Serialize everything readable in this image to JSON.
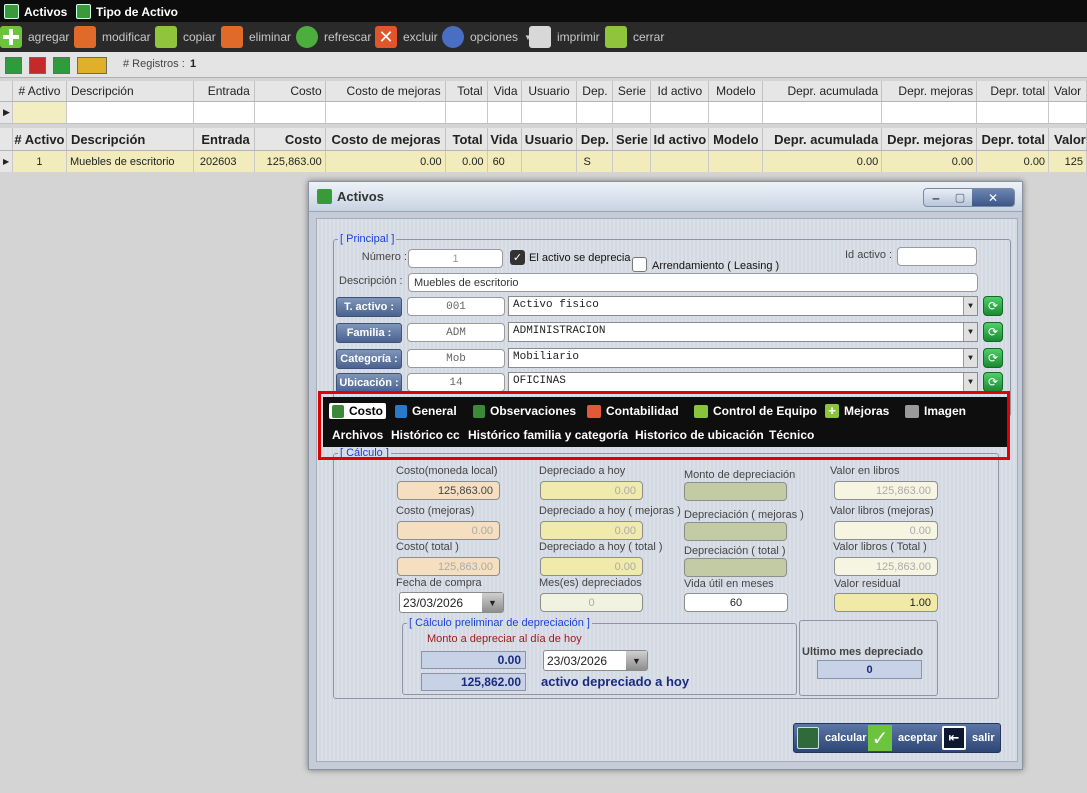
{
  "menu": {
    "item1": "Activos",
    "item2": "Tipo de Activo"
  },
  "toolbar": {
    "agregar": "agregar",
    "modificar": "modificar",
    "copiar": "copiar",
    "eliminar": "eliminar",
    "refrescar": "refrescar",
    "excluir": "excluir",
    "opciones": "opciones",
    "imprimir": "imprimir",
    "cerrar": "cerrar"
  },
  "nav": {
    "registros_label": "# Registros :",
    "registros_value": "1"
  },
  "columns": [
    "# Activo",
    "Descripción",
    "Entrada",
    "Costo",
    "Costo de mejoras",
    "Total",
    "Vida",
    "Usuario",
    "Dep.",
    "Serie",
    "Id activo",
    "Modelo",
    "Depr. acumulada",
    "Depr. mejoras",
    "Depr. total",
    "Valor"
  ],
  "row": {
    "activo": "1",
    "descripcion": "Muebles de escritorio",
    "entrada": "202603",
    "costo": "125,863.00",
    "costo_mejoras": "0.00",
    "total": "0.00",
    "vida": "60",
    "usuario": "",
    "dep": "S",
    "serie": "",
    "id_activo": "",
    "modelo": "",
    "depr_acumulada": "0.00",
    "depr_mejoras": "0.00",
    "depr_total": "0.00",
    "valor": "125"
  },
  "dialog": {
    "title": "Activos",
    "principal": {
      "legend": "[ Principal ]",
      "numero_label": "Número :",
      "numero_value": "1",
      "se_deprecia": "El activo se deprecia",
      "leasing": "Arrendamiento ( Leasing )",
      "id_activo_label": "Id activo :",
      "id_activo_value": "",
      "descripcion_label": "Descripción :",
      "descripcion_value": "Muebles de escritorio",
      "t_activo_btn": "T. activo :",
      "t_activo_code": "001",
      "t_activo_name": "Activo fisico",
      "familia_btn": "Familia :",
      "familia_code": "ADM",
      "familia_name": "ADMINISTRACION",
      "categoria_btn": "Categoría :",
      "categoria_code": "Mob",
      "categoria_name": "Mobiliario",
      "ubicacion_btn": "Ubicación :",
      "ubicacion_code": "14",
      "ubicacion_name": "OFICINAS"
    },
    "tabs1": [
      "Costo",
      "General",
      "Observaciones",
      "Contabilidad",
      "Control de Equipo",
      "Mejoras",
      "Imagen"
    ],
    "tabs2": [
      "Archivos",
      "Histórico cc",
      "Histórico familia y categoría",
      "Historico de ubicación",
      "Técnico"
    ],
    "calculo": {
      "legend": "[ Cálculo ]",
      "costo_local_label": "Costo(moneda local)",
      "costo_local": "125,863.00",
      "depreciado_hoy_label": "Depreciado a hoy",
      "depreciado_hoy": "0.00",
      "monto_dep_label": "Monto de depreciación",
      "monto_dep": "",
      "valor_libros_label": "Valor en libros",
      "valor_libros": "125,863.00",
      "costo_mejoras_label": "Costo (mejoras)",
      "costo_mejoras": "0.00",
      "depreciado_hoy_mejoras_label": "Depreciado a hoy ( mejoras )",
      "depreciado_hoy_mejoras": "0.00",
      "dep_mejoras_label": "Depreciación ( mejoras )",
      "dep_mejoras": "",
      "valor_libros_mejoras_label": "Valor libros (mejoras)",
      "valor_libros_mejoras": "0.00",
      "costo_total_label": "Costo( total )",
      "costo_total": "125,863.00",
      "depreciado_hoy_total_label": "Depreciado a hoy ( total )",
      "depreciado_hoy_total": "0.00",
      "dep_total_label": "Depreciación ( total )",
      "dep_total": "",
      "valor_libros_total_label": "Valor libros ( Total )",
      "valor_libros_total": "125,863.00",
      "fecha_compra_label": "Fecha de compra",
      "fecha_compra": "23/03/2026",
      "meses_dep_label": "Mes(es) depreciados",
      "meses_dep": "0",
      "vida_util_label": "Vida útil en meses",
      "vida_util": "60",
      "valor_residual_label": "Valor residual",
      "valor_residual": "1.00"
    },
    "preliminar": {
      "legend": "[ Cálculo preliminar de depreciación ]",
      "monto_label": "Monto a depreciar al día de hoy",
      "monto": "0.00",
      "fecha": "23/03/2026",
      "valor": "125,862.00",
      "estado": "activo depreciado a hoy"
    },
    "ultimo": {
      "label": "Ultimo mes depreciado",
      "value": "0"
    },
    "buttons": {
      "calcular": "calcular",
      "aceptar": "aceptar",
      "salir": "salir"
    }
  }
}
